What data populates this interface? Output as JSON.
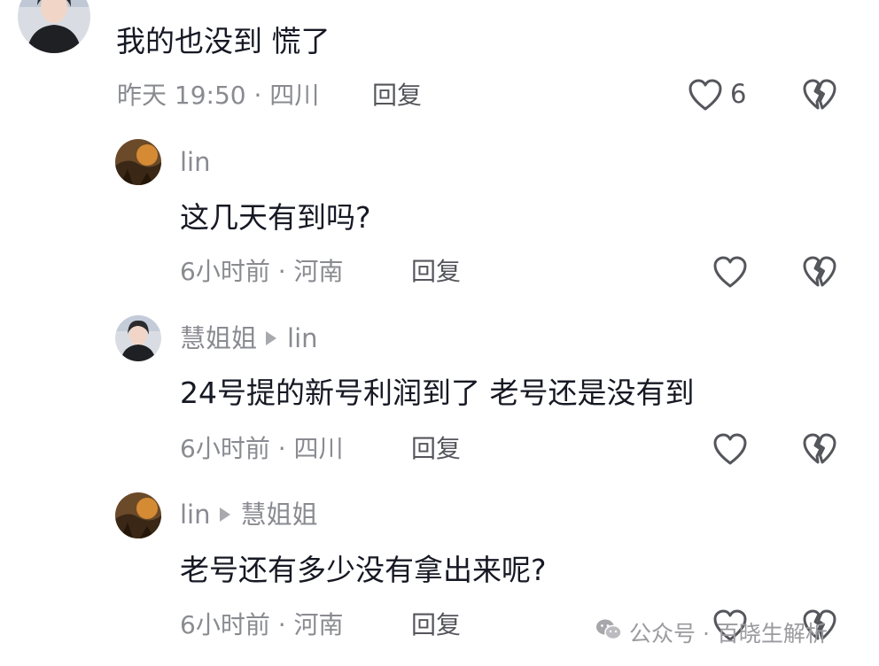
{
  "comments": [
    {
      "author": "",
      "reply_to": "",
      "text": "我的也没到 慌了",
      "meta": "昨天 19:50 · 四川",
      "reply_label": "回复",
      "like_count": "6"
    },
    {
      "author": "lin",
      "reply_to": "",
      "text": "这几天有到吗?",
      "meta": "6小时前 · 河南",
      "reply_label": "回复",
      "like_count": ""
    },
    {
      "author": "慧姐姐",
      "reply_to": "lin",
      "text": "24号提的新号利润到了 老号还是没有到",
      "meta": "6小时前 · 四川",
      "reply_label": "回复",
      "like_count": ""
    },
    {
      "author": "lin",
      "reply_to": "慧姐姐",
      "text": "老号还有多少没有拿出来呢?",
      "meta": "6小时前 · 河南",
      "reply_label": "回复",
      "like_count": ""
    }
  ],
  "icons": {
    "like": "heart-outline-icon",
    "dislike": "broken-heart-icon",
    "reply_arrow": "play-arrow-icon"
  },
  "watermark": {
    "text": "公众号 · 百晓生解析",
    "icon": "wechat-icon"
  },
  "colors": {
    "text_primary": "#161823",
    "text_secondary": "#8a8b91",
    "icon": "#55565c"
  }
}
